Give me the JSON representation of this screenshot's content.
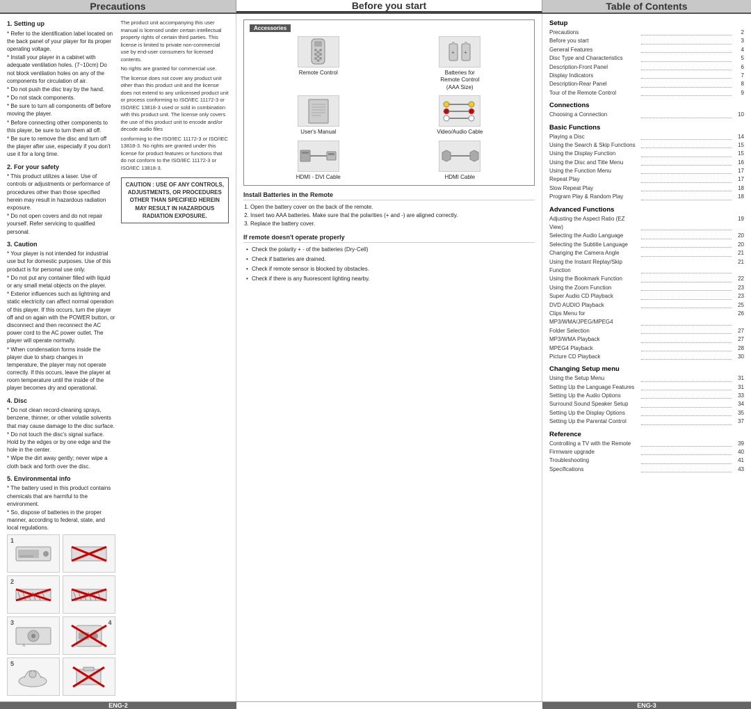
{
  "header": {
    "precautions": "Precautions",
    "before": "Before you start",
    "toc": "Table of Contents"
  },
  "footer": {
    "left": "ENG-2",
    "right": "ENG-3"
  },
  "precautions": {
    "sections": [
      {
        "title": "1. Setting up",
        "items": [
          "* Refer to the identification label located on the back panel of your player for its proper operating voltage.",
          "* Install your player in a cabinet with adequate ventilation holes. (7~10cm) Do not block ventilation holes on any of the components for circulation of air.",
          "* Do not push the disc tray by the hand.",
          "* Do not stack components.",
          "* Be sure to turn all components off before moving the player.",
          "* Before connecting other components to this player, be sure to turn them all off.",
          "* Be sure to remove the disc and turn off the player after use, especially if you don't use it for a long time."
        ]
      },
      {
        "title": "2. For your safety",
        "items": [
          "* This product utilizes a laser. Use of controls or adjustments or performance of procedures other than those specified herein may result in hazardous radiation exposure.",
          "* Do not open covers and do not repair yourself. Refer servicing to qualified personal."
        ]
      },
      {
        "title": "3. Caution",
        "items": [
          "* Your player is not intended for industrial use but for domestic purposes. Use of this product is for personal use only.",
          "* Do not put any container filled with liquid or any small metal objects on the player.",
          "* Exterior influences such as lightning and static electricity can affect normal operation of this player. If this occurs, turn the player off and on again with the POWER button, or disconnect and then reconnect the AC power cord to the AC power outlet. The player will operate normally.",
          "* When condensation forms inside the player due to sharp changes in temperature, the player may not operate correctly. If this occurs, leave the player at room temperature until the inside of the player becomes dry and operational."
        ]
      },
      {
        "title": "4. Disc",
        "items": [
          "* Do not clean record-cleaning sprays, benzene, thinner, or other volatile solvents that may cause damage to the disc surface.",
          "* Do not touch the disc's signal surface. Hold by the edges or by one edge and the hole in the center.",
          "* Wipe the dirt away gently; never wipe a cloth back and forth over the disc."
        ]
      },
      {
        "title": "5. Environmental info",
        "items": [
          "* The battery used in this product contains chemicals that are harmful to the environment.",
          "* So, dispose of batteries in the proper manner, according to federal, state, and local regulations."
        ]
      }
    ],
    "license_text": "The product unit accompanying this user manual is licensed under certain intellectual property rights of certain third parties. This license is limited to private non-commercial use by end-user consumers for licensed contents.\nNo rights are granted for commercial use.\nThe license does not cover any product unit other than this product unit and the license does not extend to any unlicensed product unit or process conforming to ISO/IEC 11172-3 or ISO/IEC 13818-3 used or sold in combination with this product unit. The license only covers the use of this product unit to encode and/or decode audio files\nconforming to the ISO/IEC 11172-3 or ISO/IEC 13818-3. No rights are granted under this license for product features or functions that do not conform to the ISO/IEC 11172-3 or ISO/IEC 13818-3.",
    "warning_text": "CAUTION : USE OF ANY CONTROLS, ADJUSTMENTS, OR PROCEDURES OTHER THAN SPECIFIED HEREIN MAY RESULT IN HAZARDOUS RADIATION EXPOSURE."
  },
  "before": {
    "accessories_title": "Accessories",
    "items": [
      {
        "label": "Remote Control",
        "icon": "remote"
      },
      {
        "label": "Batteries for\nRemote Control\n(AAA Size)",
        "icon": "batteries"
      },
      {
        "label": "User's Manual",
        "icon": "manual"
      },
      {
        "label": "Video/Audio Cable",
        "icon": "av-cable"
      },
      {
        "label": "HDMI - DVI Cable",
        "icon": "hdmi-dvi"
      },
      {
        "label": "HDMI Cable",
        "icon": "hdmi"
      }
    ],
    "install_title": "Install Batteries in the Remote",
    "install_steps": [
      "Open the battery cover on the back of the remote.",
      "Insert two AAA batteries. Make sure that the polarities (+ and -) are aligned correctly.",
      "Replace the battery cover."
    ],
    "remote_title": "If remote doesn't operate properly",
    "remote_steps": [
      "Check the polarity + - of the batteries (Dry-Cell)",
      "Check if batteries are drained.",
      "Check if remote sensor is blocked by obstacles.",
      "Check if there is any fluorescent lighting nearby."
    ]
  },
  "toc": {
    "sections": [
      {
        "title": "Setup",
        "items": [
          {
            "label": "Precautions",
            "page": "2"
          },
          {
            "label": "Before you start",
            "page": "3"
          },
          {
            "label": "General Features",
            "page": "4"
          },
          {
            "label": "Disc Type and Characteristics",
            "page": "5"
          },
          {
            "label": "Description-Front Panel",
            "page": "6"
          },
          {
            "label": "Display Indicators",
            "page": "7"
          },
          {
            "label": "Description-Rear Panel",
            "page": "8"
          },
          {
            "label": "Tour of the Remote Control",
            "page": "9"
          }
        ]
      },
      {
        "title": "Connections",
        "items": [
          {
            "label": "Choosing a Connection",
            "page": "10"
          }
        ]
      },
      {
        "title": "Basic Functions",
        "items": [
          {
            "label": "Playing a Disc",
            "page": "14"
          },
          {
            "label": "Using the Search & Skip Functions",
            "page": "15"
          },
          {
            "label": "Using the Display Function",
            "page": "15"
          },
          {
            "label": "Using the Disc and Title Menu",
            "page": "16"
          },
          {
            "label": "Using the Function Menu",
            "page": "17"
          },
          {
            "label": "Repeat Play",
            "page": "17"
          },
          {
            "label": "Slow Repeat Play",
            "page": "18"
          },
          {
            "label": "Program Play & Random Play",
            "page": "18"
          }
        ]
      },
      {
        "title": "Advanced Functions",
        "items": [
          {
            "label": "Adjusting the Aspect Ratio (EZ View)",
            "page": "19"
          },
          {
            "label": "Selecting the Audio Language",
            "page": "20"
          },
          {
            "label": "Selecting the Subtitle Language",
            "page": "20"
          },
          {
            "label": "Changing the Camera Angle",
            "page": "21"
          },
          {
            "label": "Using the Instant Replay/Skip Function",
            "page": "21"
          },
          {
            "label": "Using the Bookmark Function",
            "page": "22"
          },
          {
            "label": "Using the Zoom Function",
            "page": "23"
          },
          {
            "label": "Super Audio CD Playback",
            "page": "23"
          },
          {
            "label": "DVD AUDIO Playback",
            "page": "25"
          },
          {
            "label": "Clips Menu for MP3/WMA/JPEG/MPEG4",
            "page": "26"
          },
          {
            "label": "Folder Selection",
            "page": "27"
          },
          {
            "label": "MP3/WMA Playback",
            "page": "27"
          },
          {
            "label": "MPEG4 Playback",
            "page": "28"
          },
          {
            "label": "Picture CD Playback",
            "page": "30"
          }
        ]
      },
      {
        "title": "Changing Setup menu",
        "items": [
          {
            "label": "Using the Setup Menu",
            "page": "31"
          },
          {
            "label": "Setting Up the Language Features",
            "page": "31"
          },
          {
            "label": "Setting Up the Audio Options",
            "page": "33"
          },
          {
            "label": "Surround Sound Speaker Setup",
            "page": "34"
          },
          {
            "label": "Setting Up the Display Options",
            "page": "35"
          },
          {
            "label": "Setting Up the Parental Control",
            "page": "37"
          }
        ]
      },
      {
        "title": "Reference",
        "items": [
          {
            "label": "Controlling a TV with the Remote",
            "page": "39"
          },
          {
            "label": "Firmware upgrade",
            "page": "40"
          },
          {
            "label": "Troubleshooting",
            "page": "41"
          },
          {
            "label": "Specifications",
            "page": "43"
          }
        ]
      }
    ]
  }
}
